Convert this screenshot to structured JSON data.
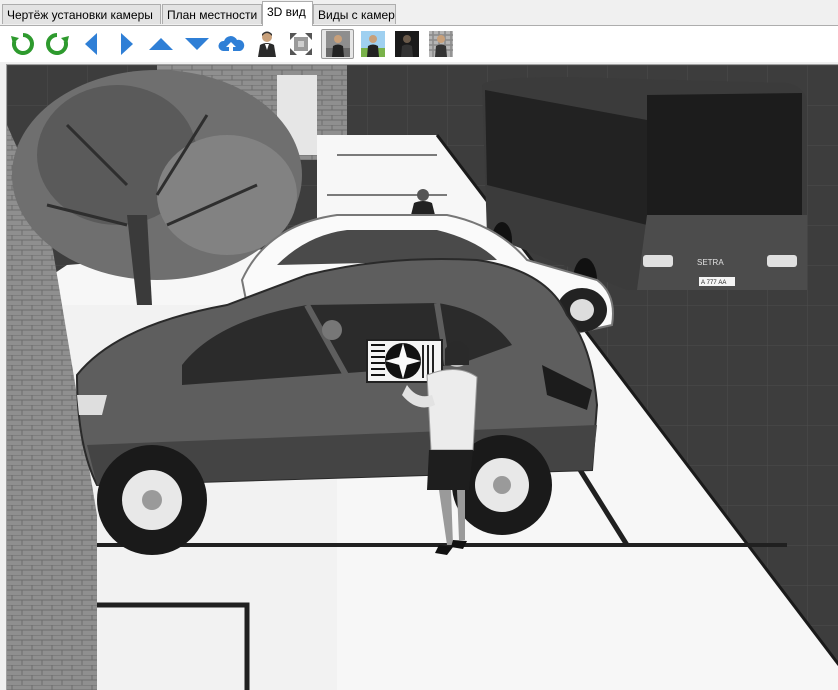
{
  "tabs": [
    {
      "label": "Чертёж установки камеры",
      "active": false
    },
    {
      "label": "План местности",
      "active": false
    },
    {
      "label": "3D вид",
      "active": true
    },
    {
      "label": "Виды с камер",
      "active": false
    }
  ],
  "toolbar": {
    "buttons": [
      {
        "icon": "rotate-ccw-icon",
        "color": "#2e9a2e"
      },
      {
        "icon": "rotate-cw-icon",
        "color": "#2e9a2e"
      },
      {
        "icon": "arrow-left-icon",
        "color": "#2f7fd6"
      },
      {
        "icon": "arrow-right-icon",
        "color": "#2f7fd6"
      },
      {
        "icon": "arrow-up-icon",
        "color": "#2f7fd6"
      },
      {
        "icon": "arrow-down-icon",
        "color": "#2f7fd6"
      },
      {
        "icon": "cloud-up-icon",
        "color": "#2f7fd6"
      },
      {
        "icon": "person-view-icon"
      },
      {
        "icon": "fit-view-icon"
      },
      {
        "icon": "person-gray-bg-icon",
        "pressed": true
      },
      {
        "icon": "person-landscape-bg-icon"
      },
      {
        "icon": "person-dark-bg-icon"
      },
      {
        "icon": "person-pattern-bg-icon"
      }
    ]
  },
  "scene": {
    "bus_plate": "А 777 АА",
    "bus_brand": "SETRA"
  }
}
